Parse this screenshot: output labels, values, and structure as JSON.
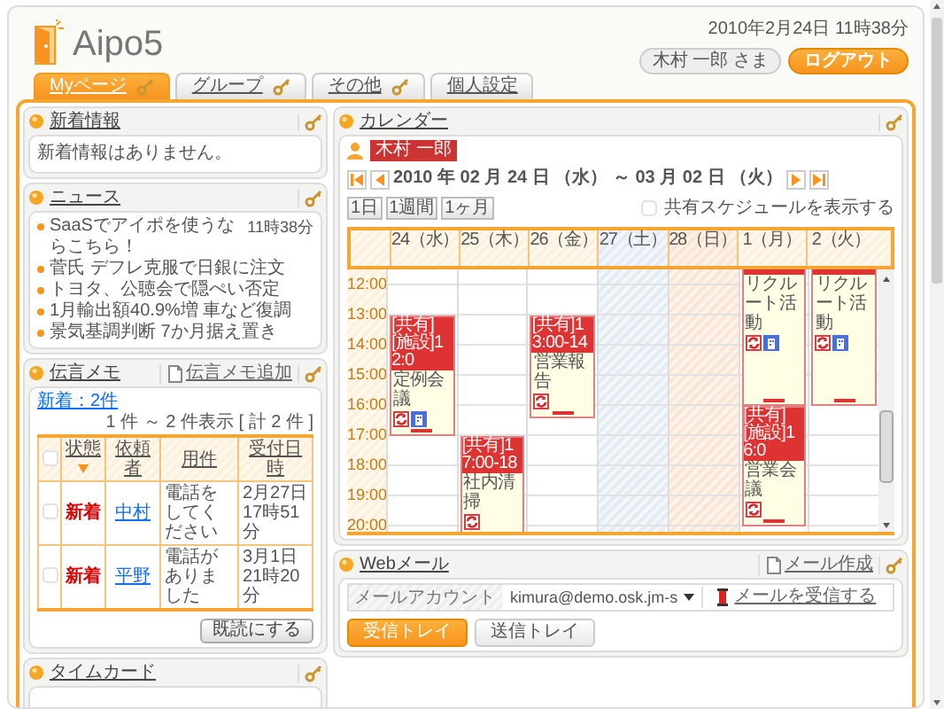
{
  "header": {
    "logo": "Aipo5",
    "datetime": "2010年2月24日 11時38分",
    "user": "木村 一郎 さま",
    "logout": "ログアウト"
  },
  "tabs": [
    {
      "label": "Myページ",
      "selected": true,
      "settings": true
    },
    {
      "label": "グループ",
      "selected": false,
      "settings": true
    },
    {
      "label": "その他",
      "selected": false,
      "settings": true
    },
    {
      "label": "個人設定",
      "selected": false,
      "settings": false
    }
  ],
  "whatsnew": {
    "title": "新着情報",
    "message": "新着情報はありません。"
  },
  "news": {
    "title": "ニュース",
    "items": [
      {
        "text": "SaaSでアイポを使うならこちら！",
        "time": "11時38分"
      },
      {
        "text": "菅氏 デフレ克服で日銀に注文"
      },
      {
        "text": "トヨタ、公聴会で隠ぺい否定"
      },
      {
        "text": "1月輸出額40.9%増 車など復調"
      },
      {
        "text": "景気基調判断 7か月据え置き"
      }
    ]
  },
  "memo": {
    "title": "伝言メモ",
    "action": "伝言メモ追加",
    "new_count": "新着：2件",
    "range": "1 件 ～ 2 件表示 [ 計 2 件 ]",
    "all_checked": false,
    "columns": [
      {
        "label": "状態",
        "sorted": true
      },
      {
        "label": "依頼者",
        "sorted": false
      },
      {
        "label": "用件",
        "sorted": false
      },
      {
        "label": "受付日時",
        "sorted": false
      }
    ],
    "rows": [
      {
        "checked": false,
        "status": "新着",
        "requester": "中村",
        "subject": "電話をしてください",
        "received": "2月27日 17時51分"
      },
      {
        "checked": false,
        "status": "新着",
        "requester": "平野",
        "subject": "電話がありました",
        "received": "3月1日 21時20分"
      }
    ],
    "button": "既読にする"
  },
  "timecard": {
    "title": "タイムカード"
  },
  "calendar": {
    "title": "カレンダー",
    "user": "木村 一郎",
    "range": "2010 年 02 月 24 日 （水） ～ 03 月 02 日 （火）",
    "views": [
      "1日",
      "1週間",
      "1ヶ月"
    ],
    "shared": {
      "label": "共有スケジュールを表示する",
      "checked": false
    },
    "hours": [
      "12:00",
      "13:00",
      "14:00",
      "15:00",
      "16:00",
      "17:00",
      "18:00",
      "19:00",
      "20:00"
    ],
    "days": [
      {
        "label": "24（水）",
        "kind": "weekday",
        "slots": [
          {
            "kind": "free"
          },
          {
            "kind": "free"
          },
          {
            "kind": "event",
            "title": "[共有][施設]12:0",
            "name": "定例会議",
            "repeat": true,
            "facility": true
          },
          {
            "kind": "more"
          }
        ]
      },
      {
        "label": "25（木）",
        "kind": "weekday",
        "slots": [
          {
            "kind": "free"
          },
          {
            "kind": "free"
          },
          {
            "kind": "free"
          },
          {
            "kind": "free"
          },
          {
            "kind": "free"
          },
          {
            "kind": "free"
          },
          {
            "kind": "event",
            "title": "[共有]17:00-18",
            "name": "社内清掃",
            "repeat": true
          }
        ]
      },
      {
        "label": "26（金）",
        "kind": "weekday",
        "slots": [
          {
            "kind": "free"
          },
          {
            "kind": "free"
          },
          {
            "kind": "event",
            "title": "[共有]13:00-14",
            "name": "営業報告",
            "repeat": true
          }
        ]
      },
      {
        "label": "27（土）",
        "kind": "saturday"
      },
      {
        "label": "28（日）",
        "kind": "sunday"
      },
      {
        "label": "1（月）",
        "kind": "weekday",
        "slots": [
          {
            "kind": "event",
            "name": "リクルート活動",
            "repeat": true,
            "facility": true
          },
          {
            "kind": "more"
          },
          {
            "kind": "more"
          },
          {
            "kind": "more"
          },
          {
            "kind": "more"
          },
          {
            "kind": "event",
            "title": "[共有][施設]16:0",
            "name": "営業会議",
            "repeat": true
          }
        ]
      },
      {
        "label": "2（火）",
        "kind": "weekday",
        "slots": [
          {
            "kind": "event",
            "name": "リクルート活動",
            "repeat": true,
            "facility": true
          },
          {
            "kind": "more"
          },
          {
            "kind": "more"
          },
          {
            "kind": "more"
          },
          {
            "kind": "more"
          }
        ]
      }
    ]
  },
  "webmail": {
    "title": "Webメール",
    "action": "メール作成",
    "account_label": "メールアカウント",
    "account": "kimura@demo.osk.jm-s",
    "receive": "メールを受信する",
    "trays": [
      {
        "label": "受信トレイ",
        "selected": true
      },
      {
        "label": "送信トレイ",
        "selected": false
      }
    ]
  }
}
